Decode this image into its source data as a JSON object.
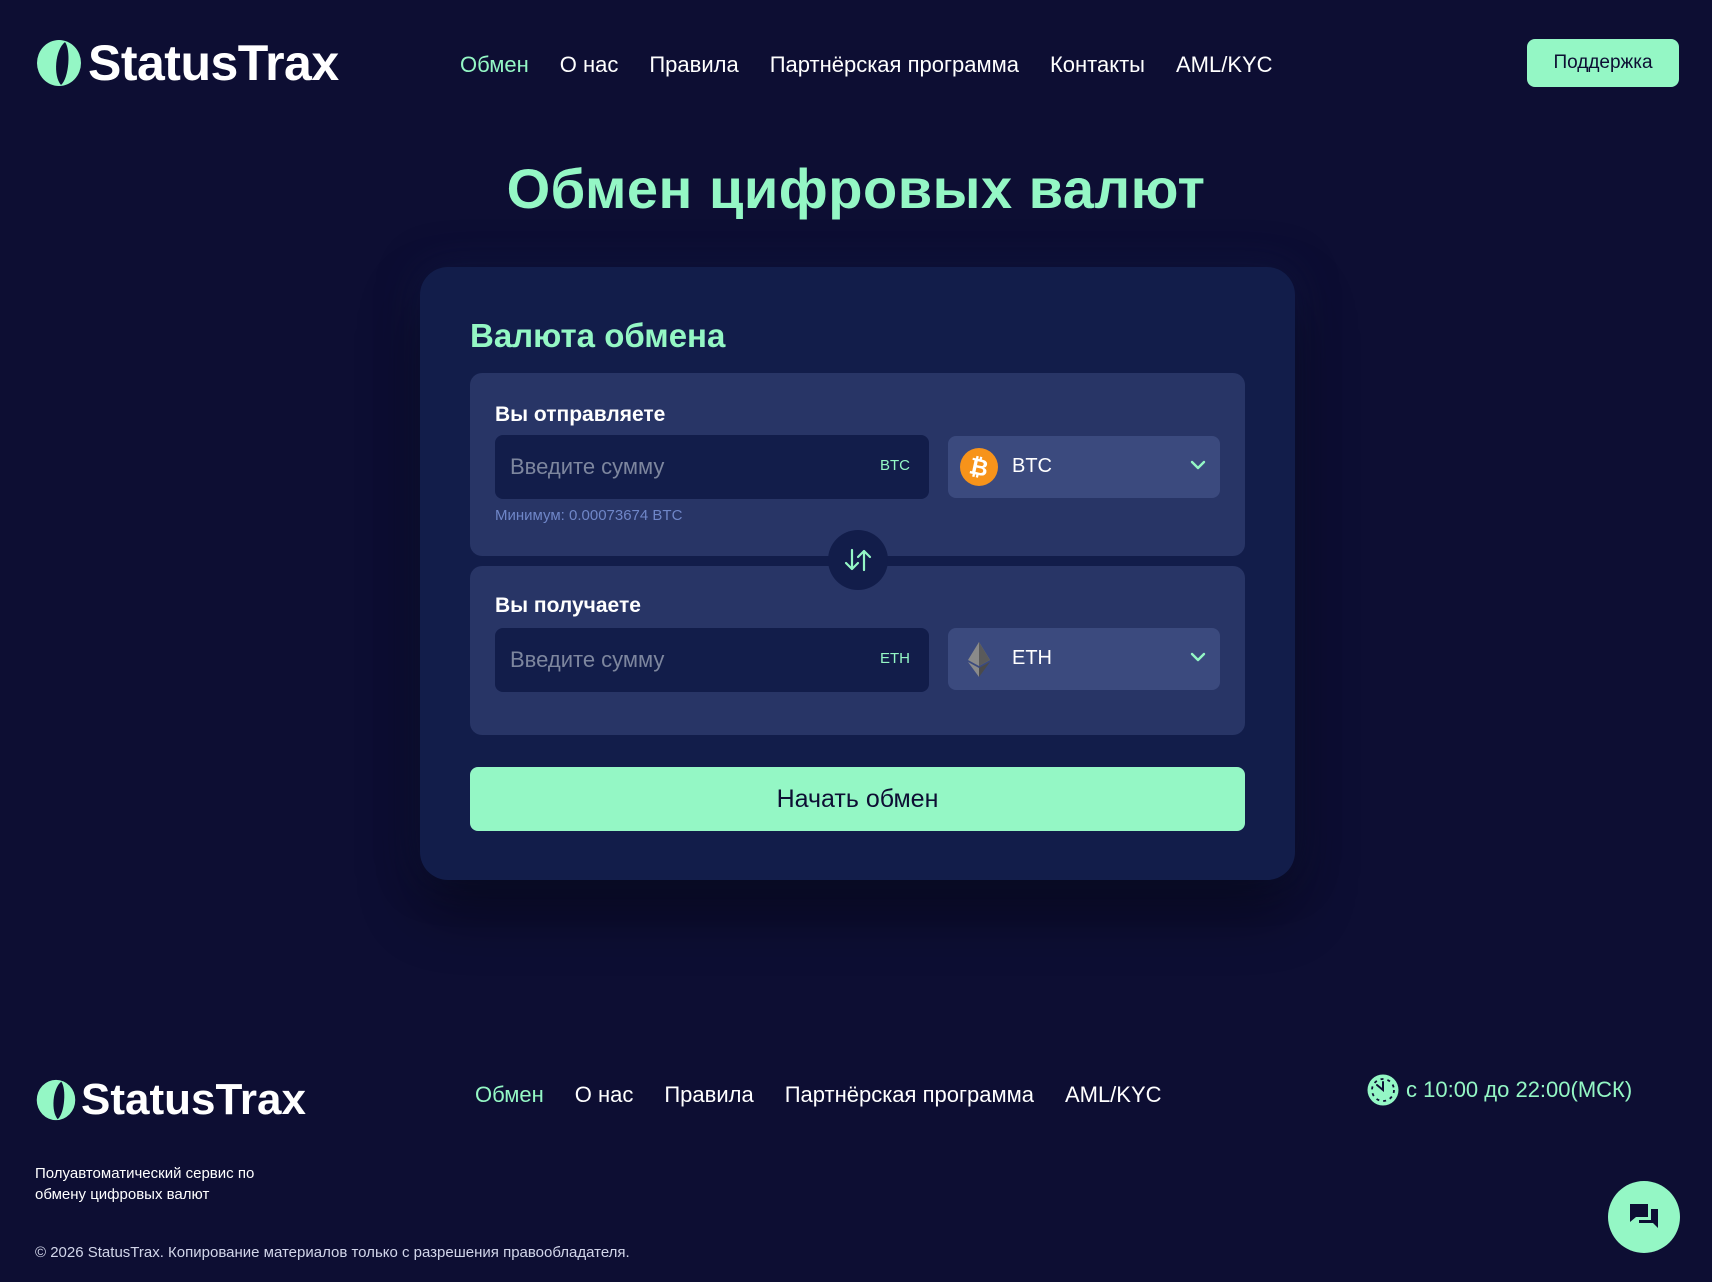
{
  "brand": {
    "name": "StatusTrax"
  },
  "header": {
    "nav": [
      {
        "label": "Обмен",
        "active": true
      },
      {
        "label": "О нас"
      },
      {
        "label": "Правила"
      },
      {
        "label": "Партнёрская программа"
      },
      {
        "label": "Контакты"
      },
      {
        "label": "AML/KYC"
      }
    ],
    "support_label": "Поддержка"
  },
  "main": {
    "title": "Обмен цифровых валют",
    "card_title": "Валюта обмена",
    "send": {
      "label": "Вы отправляете",
      "placeholder": "Введите сумму",
      "code": "BTC",
      "selected": "BTC",
      "icon": "bitcoin-icon",
      "min_note": "Минимум: 0.00073674 BTC"
    },
    "receive": {
      "label": "Вы получаете",
      "placeholder": "Введите сумму",
      "code": "ETH",
      "selected": "ETH",
      "icon": "ethereum-icon"
    },
    "swap_icon": "swap-arrows-icon",
    "start_label": "Начать обмен"
  },
  "footer": {
    "nav": [
      {
        "label": "Обмен",
        "active": true
      },
      {
        "label": "О нас"
      },
      {
        "label": "Правила"
      },
      {
        "label": "Партнёрская программа"
      },
      {
        "label": "AML/KYC"
      }
    ],
    "hours": "с 10:00 до 22:00(МСК)",
    "tagline": "Полуавтоматический сервис по обмену цифровых валют",
    "copyright": "© 2026 StatusTrax. Копирование материалов только с разрешения правообладателя."
  },
  "colors": {
    "background": "#0d0e33",
    "accent": "#94f7c5",
    "card": "#121d4a",
    "block": "#283566",
    "select": "#3b4a7e",
    "bitcoin": "#f7931a"
  }
}
